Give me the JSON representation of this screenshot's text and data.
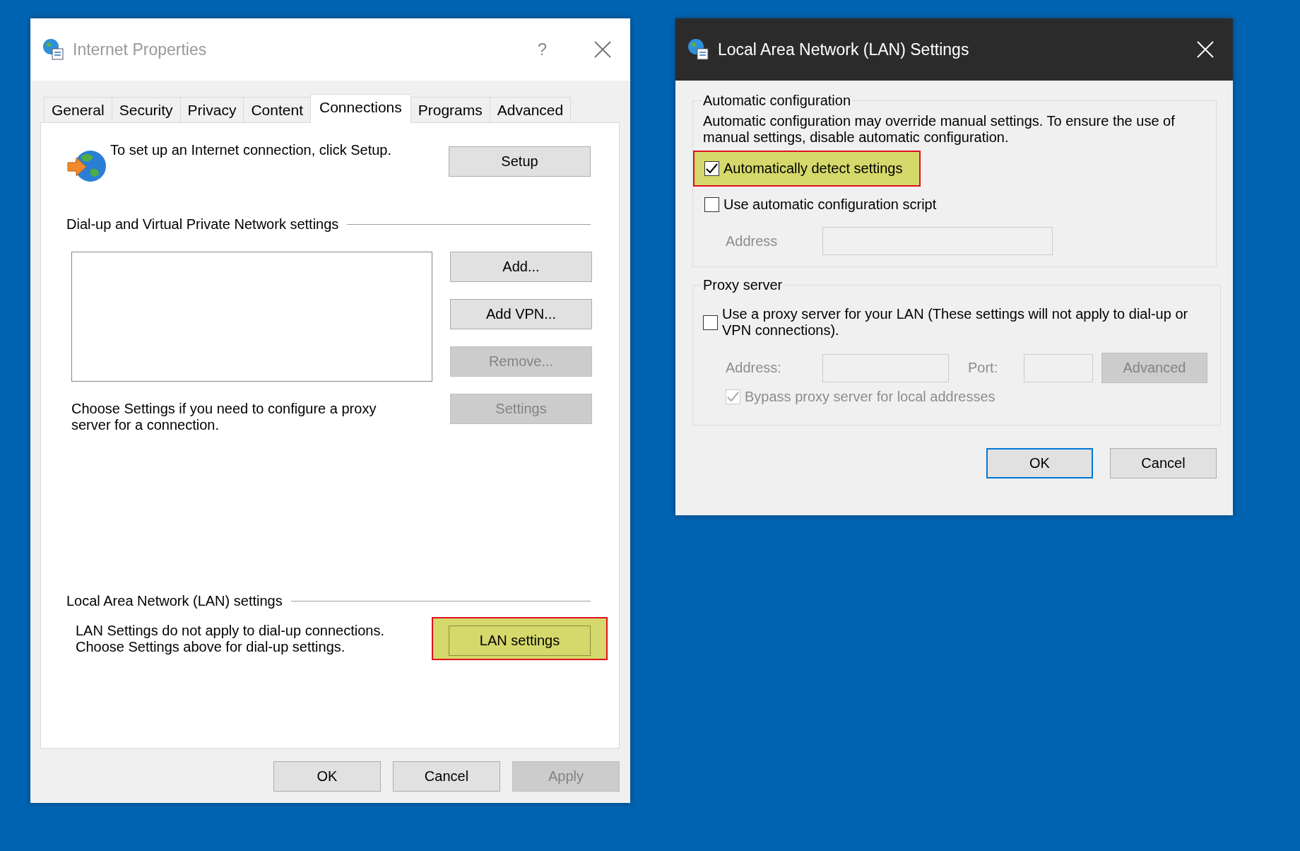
{
  "internet_properties": {
    "title": "Internet Properties",
    "help": "?",
    "tabs": [
      {
        "label": "General",
        "selected": false
      },
      {
        "label": "Security",
        "selected": false
      },
      {
        "label": "Privacy",
        "selected": false
      },
      {
        "label": "Content",
        "selected": false
      },
      {
        "label": "Connections",
        "selected": true
      },
      {
        "label": "Programs",
        "selected": false
      },
      {
        "label": "Advanced",
        "selected": false
      }
    ],
    "setup": {
      "text": "To set up an Internet connection, click Setup.",
      "button": "Setup"
    },
    "dialup": {
      "heading": "Dial-up and Virtual Private Network settings",
      "buttons": [
        {
          "label": "Add...",
          "disabled": false
        },
        {
          "label": "Add VPN...",
          "disabled": false
        },
        {
          "label": "Remove...",
          "disabled": true
        },
        {
          "label": "Settings",
          "disabled": true
        }
      ],
      "note": "Choose Settings if you need to configure a proxy server for a connection."
    },
    "lan": {
      "heading": "Local Area Network (LAN) settings",
      "text": "LAN Settings do not apply to dial-up connections. Choose Settings above for dial-up settings.",
      "button": {
        "label": "LAN settings",
        "highlighted": true
      }
    },
    "buttons": [
      {
        "label": "OK",
        "disabled": false
      },
      {
        "label": "Cancel",
        "disabled": false
      },
      {
        "label": "Apply",
        "disabled": true
      }
    ]
  },
  "lan_settings": {
    "title": "Local Area Network (LAN) Settings",
    "auto_config": {
      "heading": "Automatic configuration",
      "description": "Automatic configuration may override manual settings.  To ensure the use of manual settings, disable automatic configuration.",
      "options": [
        {
          "label": "Automatically detect settings",
          "checked": true,
          "highlighted": true
        },
        {
          "label": "Use automatic configuration script",
          "checked": false,
          "highlighted": false
        }
      ],
      "address": {
        "label": "Address",
        "disabled": true
      }
    },
    "proxy": {
      "heading": "Proxy server",
      "use_proxy": {
        "label": "Use a proxy server for your LAN (These settings will not apply to dial-up or VPN connections).",
        "checked": false
      },
      "address": {
        "label": "Address:",
        "disabled": true
      },
      "port": {
        "label": "Port:",
        "disabled": true
      },
      "advanced_button": {
        "label": "Advanced",
        "disabled": true
      },
      "bypass": {
        "label": "Bypass proxy server for local addresses",
        "checked": true,
        "disabled": true
      }
    },
    "buttons": [
      {
        "label": "OK",
        "default": true
      },
      {
        "label": "Cancel",
        "default": false
      }
    ]
  }
}
